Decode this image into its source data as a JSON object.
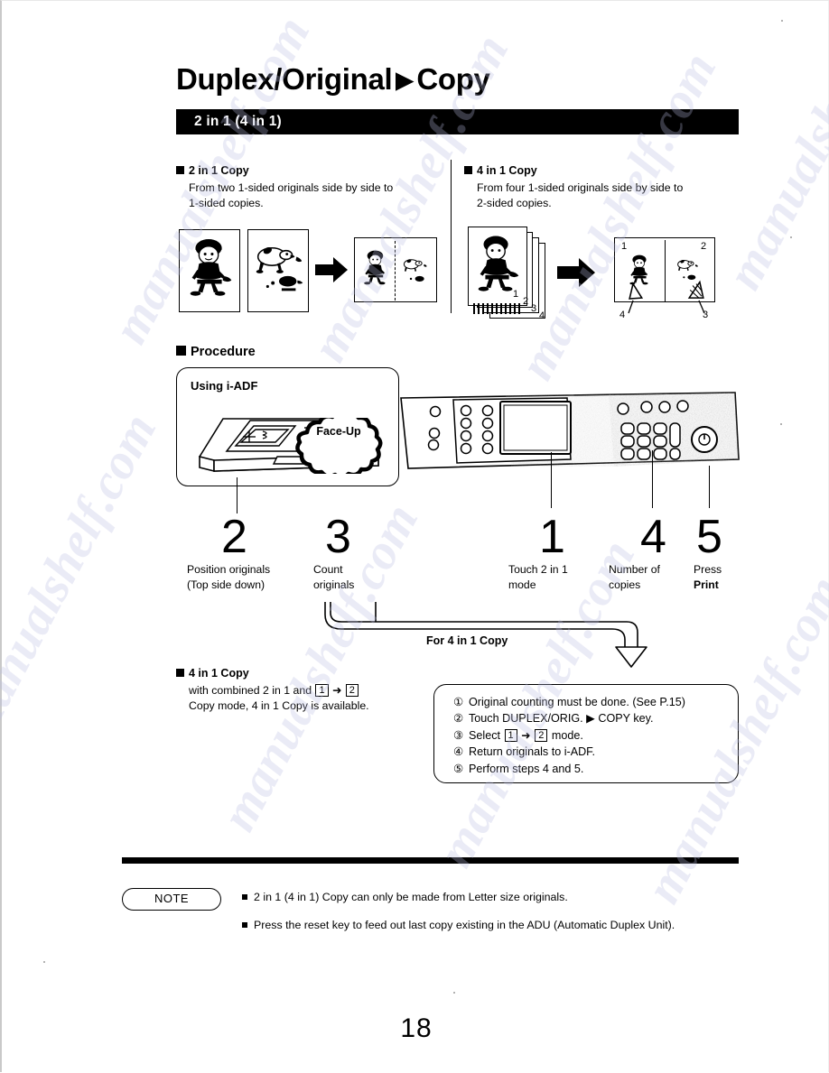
{
  "document": {
    "title": "Duplex/Original ▶ Copy",
    "title_part1": "Duplex/Original",
    "title_triangle": "▶",
    "title_part2": "Copy",
    "section_bar": "2 in 1 (4 in 1)",
    "page_number": "18"
  },
  "modes": {
    "left": {
      "heading": "2 in 1 Copy",
      "description": "From two 1-sided originals side by side to\n1-sided copies."
    },
    "right": {
      "heading": "4 in 1 Copy",
      "description": "From four 1-sided originals side by side to\n2-sided copies."
    }
  },
  "illustration": {
    "left_output_pages": [],
    "right_stack_labels": [
      "1",
      "2",
      "3",
      "4"
    ],
    "right_output_front": [
      "1",
      "2"
    ],
    "right_output_back": [
      "4",
      "3"
    ],
    "arrow_glyph": "➡"
  },
  "procedure": {
    "heading": "Procedure",
    "adf_box_label": "Using i-ADF",
    "cloud_label": "Face-Up"
  },
  "steps": [
    {
      "number": "2",
      "text": "Position originals\n(Top side down)"
    },
    {
      "number": "3",
      "text": "Count\noriginals"
    },
    {
      "number": "1",
      "text": "Touch 2 in 1\nmode"
    },
    {
      "number": "4",
      "text": "Number of\ncopies"
    },
    {
      "number": "5",
      "text_line1": "Press",
      "text_line2": "Print"
    }
  ],
  "band": {
    "label": "For 4 in 1 Copy"
  },
  "four_in_one": {
    "heading": "4 in 1 Copy",
    "line1_a": "with combined 2 in 1 and",
    "line1_box1": "1",
    "line1_arrow": "➜",
    "line1_box2": "2",
    "line2": "Copy mode, 4 in 1 Copy is available."
  },
  "instructions": [
    {
      "marker": "①",
      "text": "Original counting must be done. (See P.15)"
    },
    {
      "marker": "②",
      "text": "Touch DUPLEX/ORIG. ▶ COPY key."
    },
    {
      "marker": "③",
      "prefix": "Select",
      "box1": "1",
      "arrow": "➜",
      "box2": "2",
      "suffix": "mode."
    },
    {
      "marker": "④",
      "text": "Return originals to i-ADF."
    },
    {
      "marker": "⑤",
      "text": "Perform steps 4 and 5."
    }
  ],
  "note": {
    "label": "NOTE",
    "items": [
      "2 in 1 (4 in 1) Copy can only be made from Letter size originals.",
      "Press the reset key to feed out last copy existing in the ADU (Automatic Duplex Unit)."
    ]
  },
  "watermark": {
    "text": "manualshelf.com"
  },
  "colors": {
    "ink": "#000000",
    "paper": "#ffffff",
    "watermark": "#b9bbe0"
  }
}
